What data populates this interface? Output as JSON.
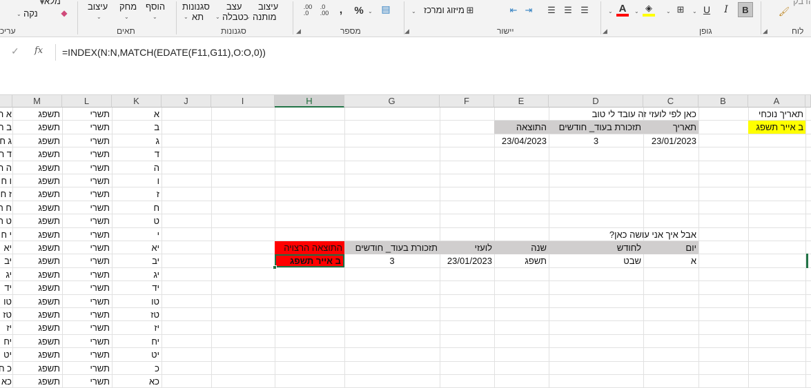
{
  "ribbon": {
    "clipboard": {
      "label": "לוח",
      "paste": "הדבק"
    },
    "font": {
      "label": "גופן",
      "bold": "B",
      "italic": "I",
      "underline": "U"
    },
    "alignment": {
      "label": "יישור",
      "merge": "מיזוג ומרכז"
    },
    "number": {
      "label": "מספר",
      "percent": "%",
      "comma": ",",
      "inc_decimal": ".00",
      "dec_decimal": ".0"
    },
    "styles": {
      "label": "סגנונות",
      "conditional": "עיצוב",
      "conditional2": "מותנה",
      "table": "עצב",
      "table2": "כטבלה",
      "cell_styles": "סגנונות",
      "cell_styles2": "תא"
    },
    "cells": {
      "label": "תאים",
      "insert": "הוסף",
      "delete": "מחק",
      "format": "עיצוב"
    },
    "editing": {
      "label": "עריכ",
      "sum": "מלא",
      "clear": "נקה"
    }
  },
  "formula_bar": {
    "cancel": "✓",
    "fx": "fx",
    "formula": "=INDEX(N:N,MATCH(EDATE(F11,G11),O:O,0))"
  },
  "columns": [
    "A",
    "B",
    "C",
    "D",
    "E",
    "F",
    "G",
    "H",
    "I",
    "J",
    "K",
    "L",
    "M"
  ],
  "cells": {
    "A1": "תאריך נוכחי",
    "A2": "ב אייר תשפג",
    "C1": "כאן לפי לועזי זה עובד לי טוב",
    "C2": "תאריך",
    "D2": "תזכורת בעוד_ חודשים",
    "E2": "התוצאה",
    "C3": "23/01/2023",
    "D3": "3",
    "E3": "23/04/2023",
    "C10": "אבל איך אני עושה כאן?",
    "C11": "יום",
    "D11": "לחודש",
    "E11": "שנה",
    "F11": "לועזי",
    "G11": "תזכורת בעוד_ חודשים",
    "H11": "התוצאה הרצויה",
    "C12": "א",
    "D12": "שבט",
    "E12": "תשפג",
    "F12": "23/01/2023",
    "G12": "3",
    "H12": "ב אייר תשפג"
  },
  "list_k": [
    "א",
    "ב",
    "ג",
    "ד",
    "ה",
    "ו",
    "ז",
    "ח",
    "ט",
    "י",
    "יא",
    "יב",
    "יג",
    "יד",
    "טו",
    "טז",
    "יז",
    "יח",
    "יט",
    "כ",
    "כא"
  ],
  "list_l": "תשרי",
  "list_m": "תשפג",
  "list_n": [
    "א ת",
    "ב ח",
    "ג ח",
    "ד ח",
    "ה ח",
    "ו ח",
    "ז ח",
    "ח ח",
    "ט ח",
    "י ח",
    "יא",
    "יב",
    "יג",
    "יד",
    "טו",
    "טז",
    "יז",
    "יח",
    "יט",
    "כ ח",
    "כא"
  ],
  "colors": {
    "excel_green": "#217346",
    "header_gray": "#d0cece",
    "current_yellow": "#ffff00",
    "result_red": "#ff0000"
  }
}
